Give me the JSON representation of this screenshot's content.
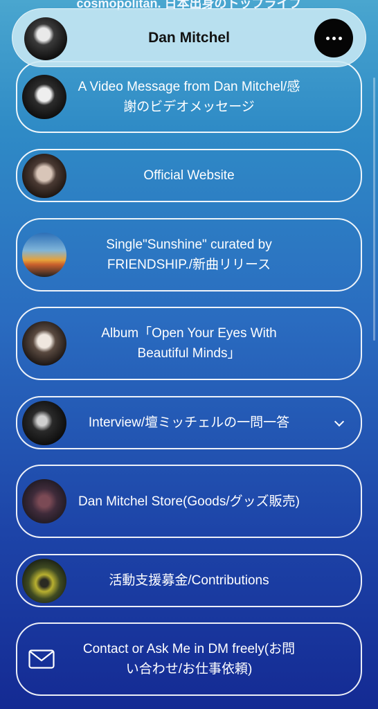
{
  "top_partial_text": "cosmopolitan. 日本出身のトップライブ",
  "header": {
    "title": "Dan Mitchel"
  },
  "links": [
    {
      "label": "A Video Message from Dan Mitchel/感謝のビデオメッセージ",
      "icon": "video-thumbnail"
    },
    {
      "label": "Official Website",
      "icon": "website-thumbnail"
    },
    {
      "label": "Single\"Sunshine\" curated by FRIENDSHIP./新曲リリース",
      "icon": "single-cover-thumbnail"
    },
    {
      "label": "Album「Open Your Eyes With Beautiful Minds」",
      "icon": "album-cover-thumbnail"
    },
    {
      "label": "Interview/壇ミッチェルの一問一答",
      "icon": "interview-thumbnail",
      "expandable": true
    },
    {
      "label": "Dan Mitchel Store(Goods/グッズ販売)",
      "icon": "store-thumbnail"
    },
    {
      "label": "活動支援募金/Contributions",
      "icon": "contributions-thumbnail"
    },
    {
      "label": "Contact or Ask Me in DM freely(お問い合わせ/お仕事依頼)",
      "icon": "mail-icon"
    }
  ]
}
